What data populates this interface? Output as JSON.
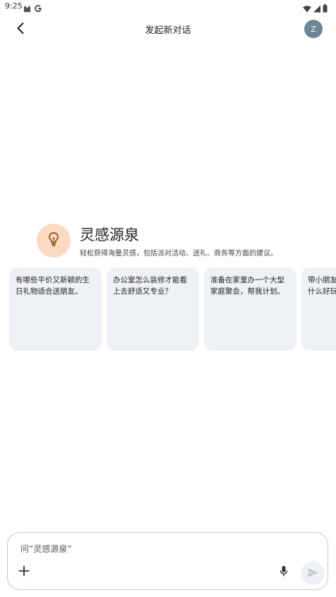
{
  "status_bar": {
    "time": "9:25",
    "icons": [
      "cat-icon",
      "google-g-icon",
      "wifi-icon",
      "signal-icon",
      "battery-icon"
    ]
  },
  "app_bar": {
    "title": "发起新对话",
    "avatar_letter": "Z"
  },
  "gem": {
    "icon": "lightbulb-icon",
    "title": "灵感源泉",
    "subtitle": "轻松获得海量灵感，包括派对活动、送礼、商务等方面的建议。"
  },
  "suggestions": [
    {
      "text": "有哪些平价又新颖的生日礼物适合送朋友。"
    },
    {
      "text": "办公室怎么装修才能看上去舒适又专业？"
    },
    {
      "text": "准备在家里办一个大型家庭聚会，帮我计划。"
    },
    {
      "text": "带小朋友去哪里玩？有什么好玩的"
    }
  ],
  "input": {
    "placeholder": "问“灵感源泉”"
  },
  "colors": {
    "gem_icon_bg": "#fcd9c2",
    "gem_icon_fg": "#8a4a12",
    "card_bg": "#eef1f6",
    "avatar_bg": "#6d8596"
  }
}
